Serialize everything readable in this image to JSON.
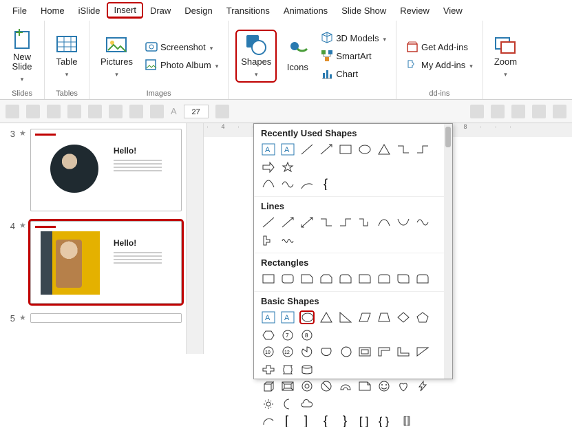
{
  "menubar": {
    "tabs": [
      "File",
      "Home",
      "iSlide",
      "Insert",
      "Draw",
      "Design",
      "Transitions",
      "Animations",
      "Slide Show",
      "Review",
      "View"
    ],
    "active_index": 3
  },
  "ribbon": {
    "slides": {
      "new_slide": "New\nSlide",
      "label": "Slides"
    },
    "tables": {
      "table": "Table",
      "label": "Tables"
    },
    "images": {
      "pictures": "Pictures",
      "screenshot": "Screenshot",
      "photo_album": "Photo Album",
      "label": "Images"
    },
    "illus": {
      "shapes": "Shapes",
      "icons": "Icons",
      "models": "3D Models",
      "smartart": "SmartArt",
      "chart": "Chart"
    },
    "addins": {
      "get": "Get Add-ins",
      "my": "My Add-ins",
      "label": "dd-ins"
    },
    "zoom": {
      "zoom": "Zoom"
    }
  },
  "quickbar": {
    "font_size": "27"
  },
  "slides_panel": {
    "items": [
      {
        "num": "3",
        "title": "Hello!",
        "active": false,
        "photo": "circle"
      },
      {
        "num": "4",
        "title": "Hello!",
        "active": true,
        "photo": "rect"
      },
      {
        "num": "5",
        "title": "",
        "active": false,
        "photo": "none"
      }
    ]
  },
  "gallery": {
    "sections": {
      "recent": "Recently Used Shapes",
      "lines": "Lines",
      "rects": "Rectangles",
      "basic": "Basic Shapes"
    }
  },
  "h_ruler": "· 4 · · · 5 · · · 6 · · · 7 · · · 8 · · ·"
}
